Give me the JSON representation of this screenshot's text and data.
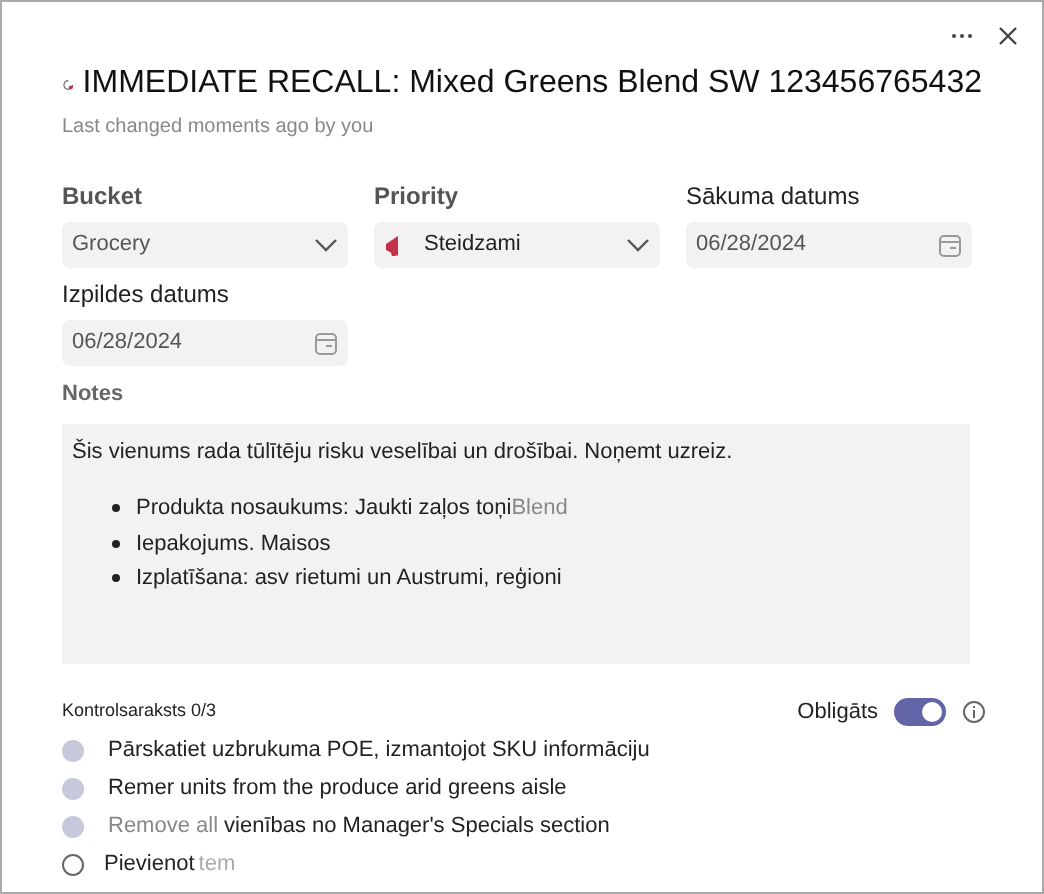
{
  "title": "IMMEDIATE RECALL: Mixed Greens Blend SW 123456765432",
  "subtitle": "Last changed moments ago by you",
  "fields": [
    {
      "kind": "select",
      "label": "Bucket",
      "value": "Grocery"
    },
    {
      "kind": "priority",
      "label": "Priority",
      "value": "Steidzami"
    },
    {
      "kind": "date",
      "label": "Sākuma datums",
      "value": "06/28/2024"
    },
    {
      "kind": "date",
      "label": "Izpildes datums",
      "value": "06/28/2024"
    }
  ],
  "notes": {
    "label": "Notes",
    "text": "Šis vienums rada tūlītēju risku veselībai un drošībai. Noņemt uzreiz.",
    "bullets": [
      {
        "text": "Produkta nosaukums: Jaukti zaļos toņi",
        "faded": "Blend"
      },
      {
        "text": "Iepakojums. Maisos"
      },
      {
        "text": "Izplatīšana: asv rietumi un Austrumi, reģioni"
      }
    ]
  },
  "checklist": {
    "label": "Kontrolsaraksts 0/3",
    "required_label": "Obligāts",
    "required": true,
    "items": [
      {
        "parts": [
          "Pārskatiet uzbrukuma POE, izmantojot SKU informāciju"
        ]
      },
      {
        "parts": [
          "Remer units from the produce arid greens aisle"
        ]
      },
      {
        "parts": [
          "Remove all",
          "vienības no",
          "Manager's Specials section"
        ]
      }
    ],
    "add": {
      "label": "Pievienot",
      "faded": "tem"
    }
  }
}
